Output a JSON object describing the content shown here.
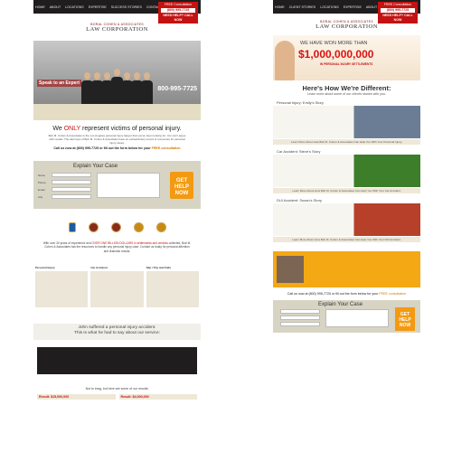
{
  "left_page": {
    "nav": {
      "items": [
        "Home",
        "About",
        "Locations",
        "Expertise",
        "Success Stories",
        "Contact"
      ]
    },
    "cta": {
      "title": "FREE Consultation",
      "phone": "(800) 995-7725",
      "help": "NEED HELP? CALL NOW"
    },
    "logo": {
      "name": "BORAL COHEN & ASSOCIATES",
      "corp": "LAW CORPORATION"
    },
    "hero": {
      "tagline": "Speak to an Expert",
      "phone": "800-995-7725"
    },
    "headline": {
      "prefix": "We ",
      "emphasis": "ONLY",
      "suffix": " represent victims of personal injury."
    },
    "intro": "Bob M. Cohen & Associates is the Los Angeles personal injury lawyer that you've been looking for. You can't argue with results. The attorneys of Bob M. Cohen & Associates have an extraordinary record of recoveries for personal injury cases.",
    "call_line": {
      "prefix": "Call us now at (800) 995-7725 or fill out the form below for your ",
      "highlight": "FREE consultation"
    },
    "form": {
      "title": "Explain Your Case",
      "labels": [
        "Name",
        "Phone",
        "Email",
        "City"
      ],
      "button": "GET HELP NOW"
    },
    "badges": [
      "bbb-badge",
      "award-seal-icon",
      "award-seal-icon",
      "award-seal-icon",
      "award-seal-icon"
    ],
    "mid": {
      "prefix": "With over 30 years of experience and ",
      "highlight": "OVER ONE BILLION DOLLARS in settlements and verdicts",
      "suffix": " collected, Bob M. Cohen & Associates has the resources to handle any personal injury case. Contact us today for personal attention and dramatic results. "
    },
    "columns": [
      {
        "heading": "Personal Injury"
      },
      {
        "heading": "Car Accident"
      },
      {
        "heading": "Slip / Trip and Falls"
      }
    ],
    "quote": {
      "line1": "John suffered a personal injury accident.",
      "line2": "This is what he had to say about our service:"
    },
    "not_brag": "Not to brag, but here are some of our results:",
    "results": [
      {
        "label": "Result: $15,000,000"
      },
      {
        "label": "Result: $4,000,000"
      }
    ]
  },
  "right_page": {
    "nav": {
      "items": [
        "Home",
        "Client Stories",
        "Locations",
        "Expertise",
        "About",
        "Contact"
      ]
    },
    "cta": {
      "title": "FREE Consultation",
      "phone": "(800) 995-7725",
      "help": "NEED HELP? CALL NOW"
    },
    "logo": {
      "name": "BORAL COHEN & ASSOCIATES",
      "corp": "LAW CORPORATION"
    },
    "hero": {
      "line1": "WE HAVE WON MORE THAN",
      "big": "$1,000,000,000",
      "line3": "IN PERSONAL INJURY SETTLEMENTS"
    },
    "heading": "Here's How We're Different:",
    "subheading": "Learn more about some of our client's stories with you.",
    "stories": [
      {
        "title": "Personal Injury: Emily's Story",
        "link": "Learn More About How Bob M. Cohen & Associates Can Help You With Your Personal Injury."
      },
      {
        "title": "Car Accident: Steve's Story",
        "link": "Learn More About How Bob M. Cohen & Associates Can Help You With Your Car Accident."
      },
      {
        "title": "DUI Accident: Susan's Story",
        "link": "Learn More About How Bob M. Cohen & Associates Can Help You With Your DUI Accident."
      }
    ],
    "call_line": {
      "prefix": "Call us now at (800) 995-7725 or fill out the form below for your ",
      "highlight": "FREE consultation"
    },
    "form": {
      "title": "Explain Your Case",
      "button": "GET HELP NOW"
    }
  }
}
